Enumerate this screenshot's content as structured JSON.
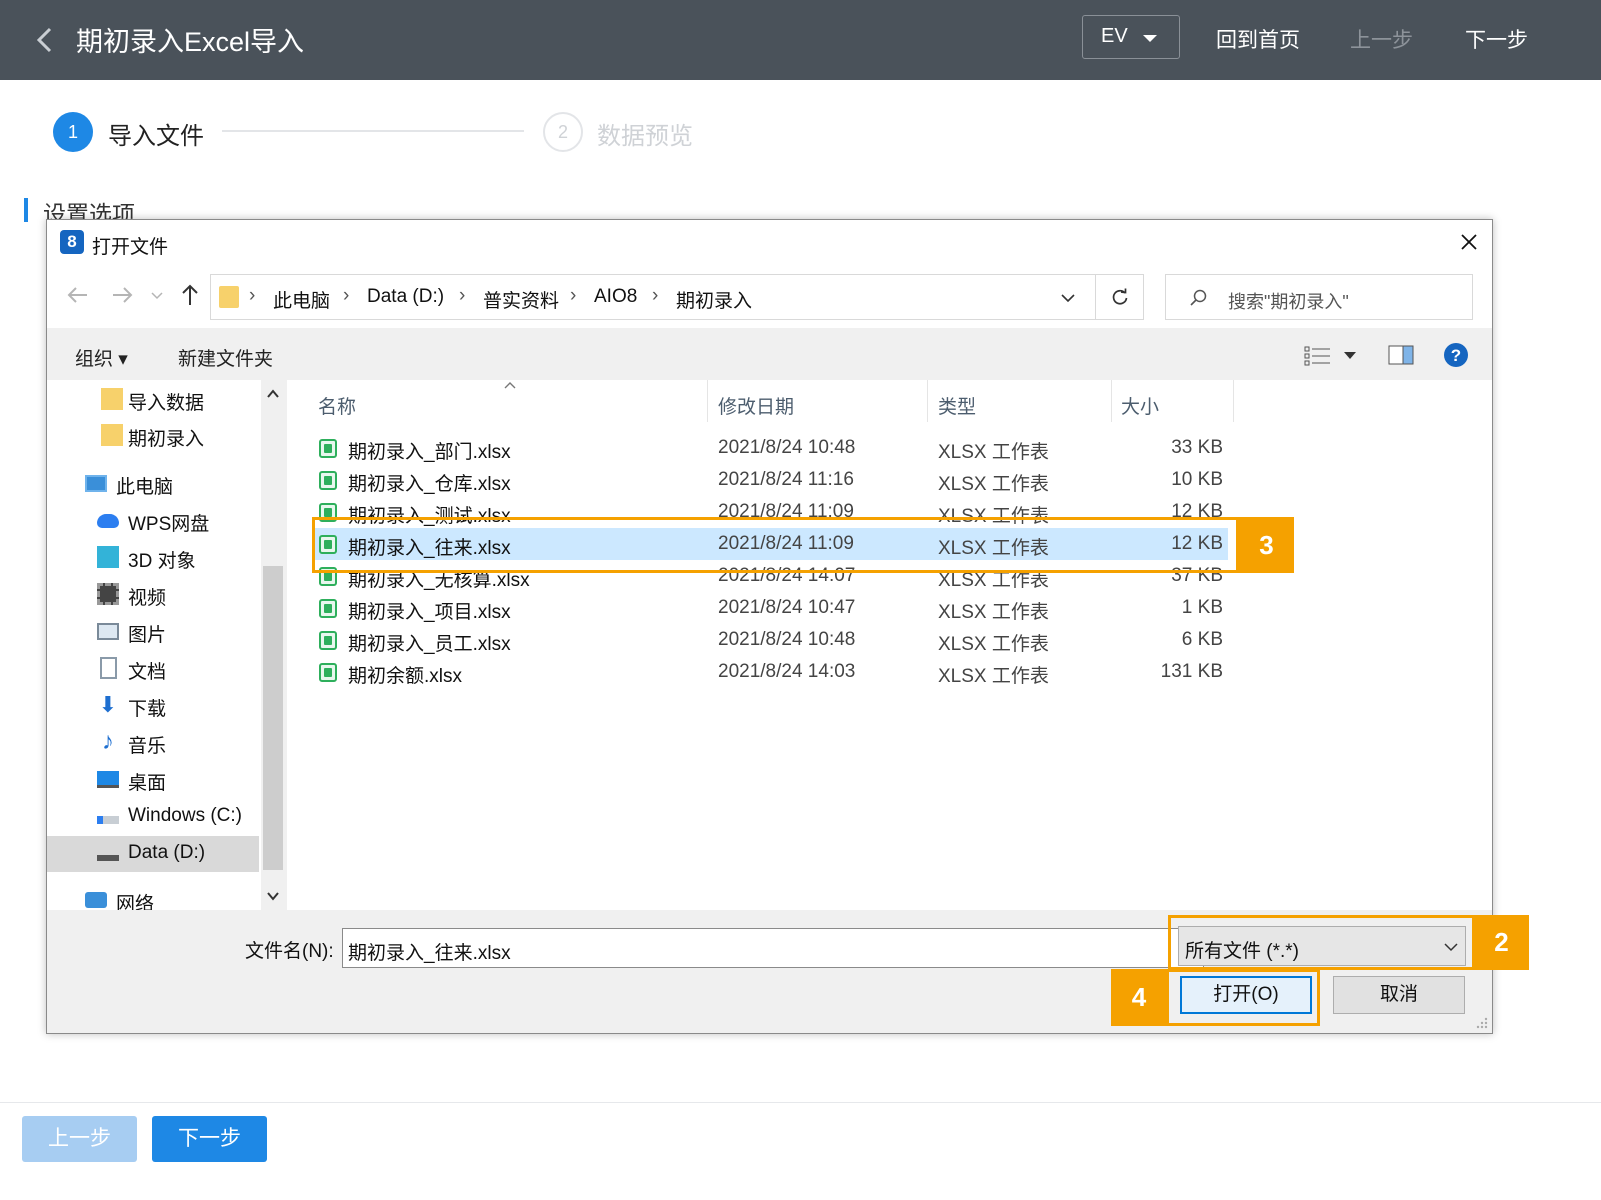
{
  "header": {
    "title": "期初录入Excel导入",
    "ev_label": "EV",
    "home_label": "回到首页",
    "prev_label": "上一步",
    "next_label": "下一步"
  },
  "steps": [
    {
      "num": "1",
      "label": "导入文件"
    },
    {
      "num": "2",
      "label": "数据预览"
    }
  ],
  "section_title": "设置选项",
  "dialog": {
    "title": "打开文件",
    "breadcrumbs": [
      "此电脑",
      "Data (D:)",
      "普实资料",
      "AIO8",
      "期初录入"
    ],
    "search_placeholder": "搜索\"期初录入\"",
    "toolbar": {
      "organize": "组织",
      "new_folder": "新建文件夹"
    },
    "nav_items": [
      {
        "label": "导入数据",
        "icon": "folder-icon"
      },
      {
        "label": "期初录入",
        "icon": "folder-icon"
      },
      {
        "label": "此电脑",
        "icon": "computer-icon"
      },
      {
        "label": "WPS网盘",
        "icon": "cloud-icon"
      },
      {
        "label": "3D 对象",
        "icon": "cube-icon"
      },
      {
        "label": "视频",
        "icon": "video-icon"
      },
      {
        "label": "图片",
        "icon": "picture-icon"
      },
      {
        "label": "文档",
        "icon": "document-icon"
      },
      {
        "label": "下载",
        "icon": "download-icon"
      },
      {
        "label": "音乐",
        "icon": "music-icon"
      },
      {
        "label": "桌面",
        "icon": "desktop-icon"
      },
      {
        "label": "Windows (C:)",
        "icon": "drive-icon"
      },
      {
        "label": "Data (D:)",
        "icon": "drive-icon"
      },
      {
        "label": "网络",
        "icon": "network-icon"
      }
    ],
    "columns": {
      "name": "名称",
      "date": "修改日期",
      "type": "类型",
      "size": "大小"
    },
    "files": [
      {
        "name": "期初录入_部门.xlsx",
        "date": "2021/8/24 10:48",
        "type": "XLSX 工作表",
        "size": "33 KB"
      },
      {
        "name": "期初录入_仓库.xlsx",
        "date": "2021/8/24 11:16",
        "type": "XLSX 工作表",
        "size": "10 KB"
      },
      {
        "name": "期初录入_测试.xlsx",
        "date": "2021/8/24 11:09",
        "type": "XLSX 工作表",
        "size": "12 KB"
      },
      {
        "name": "期初录入_往来.xlsx",
        "date": "2021/8/24 11:09",
        "type": "XLSX 工作表",
        "size": "12 KB"
      },
      {
        "name": "期初录入_无核算.xlsx",
        "date": "2021/8/24 14:07",
        "type": "XLSX 工作表",
        "size": "37 KB"
      },
      {
        "name": "期初录入_项目.xlsx",
        "date": "2021/8/24 10:47",
        "type": "XLSX 工作表",
        "size": "1 KB"
      },
      {
        "name": "期初录入_员工.xlsx",
        "date": "2021/8/24 10:48",
        "type": "XLSX 工作表",
        "size": "6 KB"
      },
      {
        "name": "期初余额.xlsx",
        "date": "2021/8/24 14:03",
        "type": "XLSX 工作表",
        "size": "131 KB"
      }
    ],
    "filename_label": "文件名(N):",
    "filename_value": "期初录入_往来.xlsx",
    "filetype_value": "所有文件 (*.*)",
    "open_label": "打开(O)",
    "cancel_label": "取消"
  },
  "annotations": [
    "3",
    "2",
    "4"
  ],
  "bottom": {
    "prev_label": "上一步",
    "next_label": "下一步"
  },
  "colors": {
    "header_bg": "#4a525a",
    "accent": "#1e88e5",
    "annotation": "#f5a100",
    "selection": "#cce8ff"
  }
}
